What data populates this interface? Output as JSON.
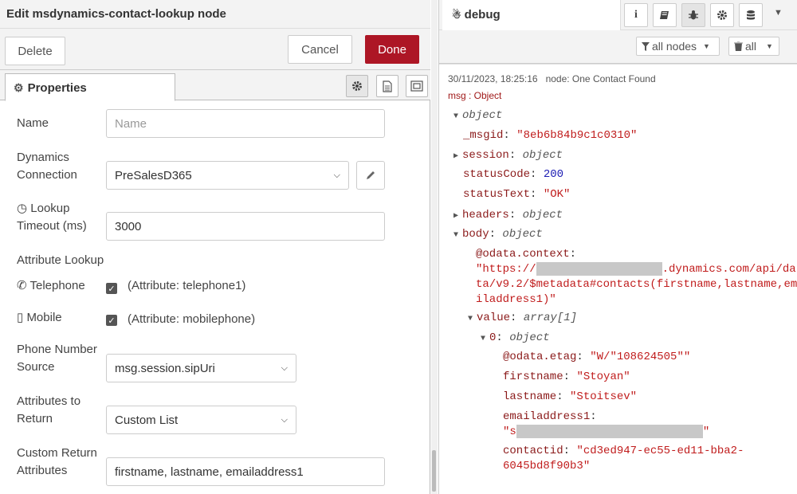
{
  "editor": {
    "title": "Edit msdynamics-contact-lookup node",
    "buttons": {
      "delete": "Delete",
      "cancel": "Cancel",
      "done": "Done"
    },
    "tab": {
      "label": "Properties",
      "icon": "gear-icon"
    },
    "tab_icons": [
      "gear-icon",
      "description-icon",
      "appearance-icon"
    ],
    "fields": {
      "name": {
        "label": "Name",
        "placeholder": "Name",
        "value": ""
      },
      "connection": {
        "label_line1": "Dynamics",
        "label_line2": "Connection",
        "value": "PreSalesD365"
      },
      "timeout": {
        "label_line1": "Lookup",
        "label_line2": "Timeout (ms)",
        "value": "3000",
        "icon": "clock-icon"
      },
      "attribute_lookup": {
        "label": "Attribute Lookup"
      },
      "telephone": {
        "label": "Telephone",
        "checked": true,
        "text": "(Attribute: telephone1)",
        "icon": "phone-icon"
      },
      "mobile": {
        "label": "Mobile",
        "checked": true,
        "text": "(Attribute: mobilephone)",
        "icon": "mobile-icon"
      },
      "phone_source": {
        "label_line1": "Phone Number",
        "label_line2": "Source",
        "value": "msg.session.sipUri"
      },
      "attributes_return": {
        "label_line1": "Attributes to",
        "label_line2": "Return",
        "value": "Custom List"
      },
      "custom_attributes": {
        "label_line1": "Custom Return",
        "label_line2": "Attributes",
        "value": "firstname, lastname, emailaddress1"
      }
    }
  },
  "sidebar": {
    "tab_label": "debug",
    "tab_icons": [
      "info-icon",
      "book-icon",
      "bug-icon",
      "gear-icon",
      "database-icon",
      "caret-down-icon"
    ],
    "filters": {
      "nodes": "all nodes",
      "clear": "all"
    },
    "message": {
      "timestamp": "30/11/2023, 18:25:16",
      "node": "node: One Contact Found",
      "type": "msg : Object",
      "tree": {
        "root_type": "object",
        "msgid_key": "_msgid",
        "msgid_val": "\"8eb6b84b9c1c0310\"",
        "session_key": "session",
        "session_type": "object",
        "statuscode_key": "statusCode",
        "statuscode_val": "200",
        "statustext_key": "statusText",
        "statustext_val": "\"OK\"",
        "headers_key": "headers",
        "headers_type": "object",
        "body_key": "body",
        "body_type": "object",
        "odata_context_key": "@odata.context",
        "odata_line1_a": "\"https://",
        "odata_line1_b": ".dynamics.com/api/da",
        "odata_line2": "ta/v9.2/$metadata#contacts(firstname,lastname,ema",
        "odata_line3": "iladdress1)\"",
        "value_key": "value",
        "value_type": "array[1]",
        "idx0_key": "0",
        "idx0_type": "object",
        "etag_key": "@odata.etag",
        "etag_val": "\"W/\"108624505\"\"",
        "firstname_key": "firstname",
        "firstname_val": "\"Stoyan\"",
        "lastname_key": "lastname",
        "lastname_val": "\"Stoitsev\"",
        "email_key": "emailaddress1",
        "email_val_start": "\"s",
        "email_val_end": "\"",
        "contactid_key": "contactid",
        "contactid_val1": "\"cd3ed947-ec55-ed11-bba2-",
        "contactid_val2": "6045bd8f90b3\""
      }
    }
  }
}
